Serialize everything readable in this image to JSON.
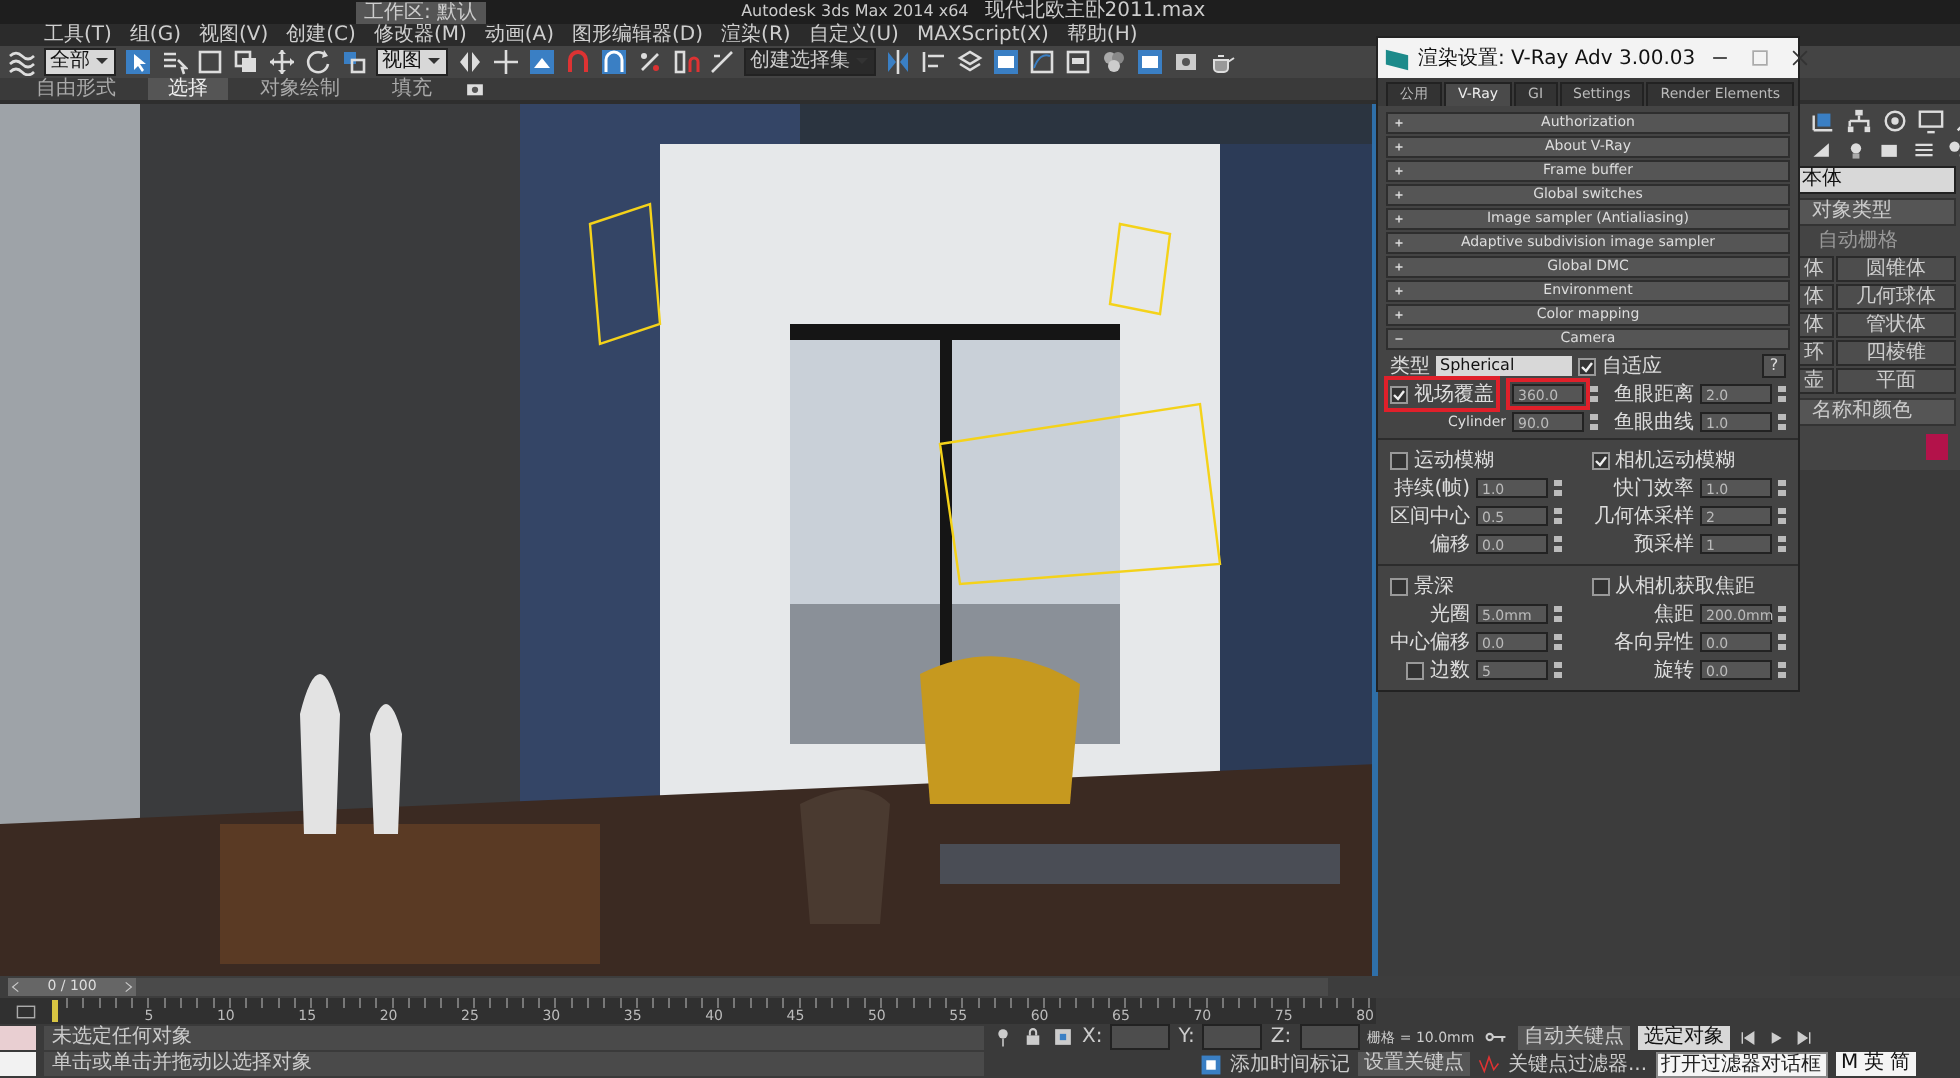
{
  "app": {
    "workspace": "工作区: 默认",
    "title": "Autodesk 3ds Max  2014 x64",
    "file": "现代北欧主卧2011.max"
  },
  "menu": [
    "工具(T)",
    "组(G)",
    "视图(V)",
    "创建(C)",
    "修改器(M)",
    "动画(A)",
    "图形编辑器(D)",
    "渲染(R)",
    "自定义(U)",
    "MAXScript(X)",
    "帮助(H)"
  ],
  "toolbar": {
    "selection_filter": "全部",
    "reference_system": "视图",
    "selection_set": "创建选择集"
  },
  "ribbon_tabs": [
    {
      "label": "自由形式",
      "selected": false
    },
    {
      "label": "选择",
      "selected": true
    },
    {
      "label": "对象绘制",
      "selected": false
    },
    {
      "label": "填充",
      "selected": false
    }
  ],
  "render_dialog": {
    "title": "渲染设置: V-Ray Adv 3.00.03",
    "tabs": [
      {
        "label": "公用",
        "selected": false
      },
      {
        "label": "V-Ray",
        "selected": true
      },
      {
        "label": "GI",
        "selected": false
      },
      {
        "label": "Settings",
        "selected": false
      },
      {
        "label": "Render Elements",
        "selected": false
      }
    ],
    "rollouts": [
      {
        "label": "Authorization",
        "expanded": false
      },
      {
        "label": "About V-Ray",
        "expanded": false
      },
      {
        "label": "Frame buffer",
        "expanded": false
      },
      {
        "label": "Global switches",
        "expanded": false
      },
      {
        "label": "Image sampler (Antialiasing)",
        "expanded": false
      },
      {
        "label": "Adaptive subdivision image sampler",
        "expanded": false
      },
      {
        "label": "Global DMC",
        "expanded": false
      },
      {
        "label": "Environment",
        "expanded": false
      },
      {
        "label": "Color mapping",
        "expanded": false
      },
      {
        "label": "Camera",
        "expanded": true
      }
    ],
    "camera": {
      "type_label": "类型",
      "type": "Spherical",
      "adapt": {
        "label": "自适应",
        "checked": true
      },
      "help": "?",
      "fov": {
        "label": "视场覆盖",
        "checked": true,
        "value": "360.0",
        "highlighted": true
      },
      "cylinder": {
        "label": "Cylinder",
        "value": "90.0"
      },
      "fisheye": [
        {
          "label": "鱼眼距离",
          "value": "2.0"
        },
        {
          "label": "鱼眼曲线",
          "value": "1.0"
        }
      ]
    },
    "sections": [
      {
        "toggles": [
          {
            "label": "运动模糊",
            "checked": false
          },
          {
            "label": "相机运动模糊",
            "checked": true
          }
        ],
        "left": [
          {
            "label": "持续(帧)",
            "value": "1.0"
          },
          {
            "label": "区间中心",
            "value": "0.5"
          },
          {
            "label": "偏移",
            "value": "0.0"
          }
        ],
        "right": [
          {
            "label": "快门效率",
            "value": "1.0"
          },
          {
            "label": "几何体采样",
            "value": "2"
          },
          {
            "label": "预采样",
            "value": "1"
          }
        ]
      },
      {
        "toggles": [
          {
            "label": "景深",
            "checked": false
          },
          {
            "label": "从相机获取焦距",
            "checked": false
          }
        ],
        "left": [
          {
            "label": "光圈",
            "value": "5.0mm"
          },
          {
            "label": "中心偏移",
            "value": "0.0"
          },
          {
            "label": "边数",
            "value": "5",
            "kind": "check",
            "checked": false
          }
        ],
        "right": [
          {
            "label": "焦距",
            "value": "200.0mm"
          },
          {
            "label": "各向异性",
            "value": "0.0"
          },
          {
            "label": "旋转",
            "value": "0.0"
          }
        ]
      }
    ]
  },
  "command_panel": {
    "category": "本体",
    "rollout": "对象类型",
    "autogrid": "自动栅格",
    "buttons": [
      "体",
      "圆锥体",
      "体",
      "几何球体",
      "体",
      "管状体",
      "环",
      "四棱锥",
      "壶",
      "平面"
    ],
    "name_color": "名称和颜色",
    "color": "#b3124a"
  },
  "timeline": {
    "frame": "0 / 100",
    "ticks": [
      "5",
      "10",
      "15",
      "20",
      "25",
      "30",
      "35",
      "40",
      "45",
      "50",
      "55",
      "60",
      "65",
      "70",
      "75",
      "80"
    ]
  },
  "status": {
    "line1": "未选定任何对象",
    "line2": "单击或单击并拖动以选择对象",
    "coords": [
      "X:",
      "Y:",
      "Z:"
    ],
    "grid": "栅格 = 10.0mm",
    "auto_key": "自动关键点",
    "key_mode": "选定对象",
    "set_key": "设置关键点",
    "key_filters": "关键点过滤器...",
    "tooltip": "打开过滤器对话框",
    "time_tag": "添加时间标记",
    "ime": [
      "M",
      "英",
      "简"
    ]
  }
}
